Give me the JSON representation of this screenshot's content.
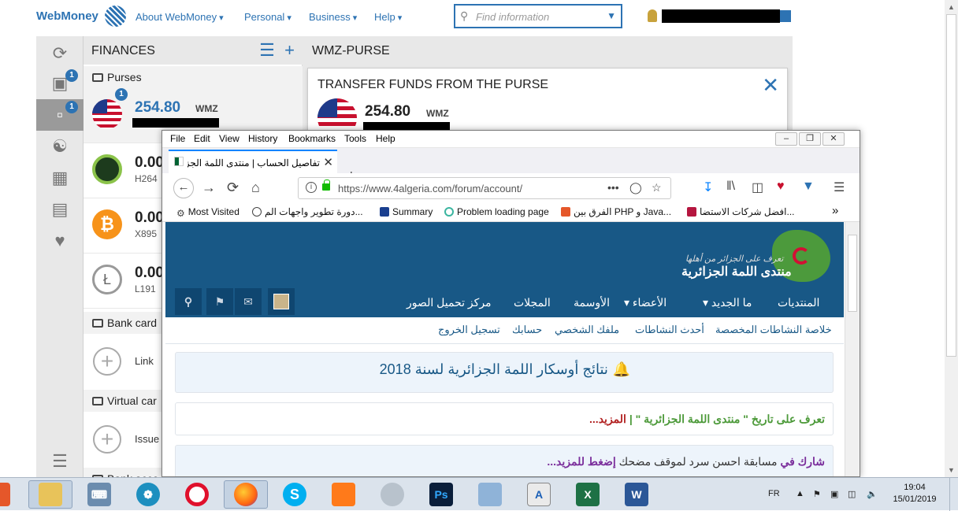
{
  "webmoney": {
    "logo": "WebMoney",
    "nav": [
      "About WebMoney",
      "Personal",
      "Business",
      "Help"
    ],
    "search_placeholder": "Find information",
    "left_badges": [
      "1",
      "1"
    ],
    "finances_title": "FINANCES",
    "purses_label": "Purses",
    "purses": [
      {
        "amount": "254.80",
        "currency": "WMZ",
        "id": "",
        "badge": "1"
      },
      {
        "amount": "0.00",
        "currency": "",
        "id": "H264"
      },
      {
        "amount": "0.00",
        "currency": "",
        "id": "X895"
      },
      {
        "amount": "0.00",
        "currency": "",
        "id": "L191"
      }
    ],
    "bank_cards_label": "Bank card",
    "link_label": "Link",
    "virtual_cards_label": "Virtual car",
    "issue_label": "Issue",
    "bank_accounts_label": "Bank acco",
    "main_title": "WMZ-PURSE",
    "transfer_title": "TRANSFER FUNDS FROM THE PURSE",
    "transfer_amount": "254.80",
    "transfer_currency": "WMZ"
  },
  "firefox": {
    "menu": [
      "File",
      "Edit",
      "View",
      "History",
      "Bookmarks",
      "Tools",
      "Help"
    ],
    "tab_title": "تفاصيل الحساب | منتدى اللمة الجزائرية",
    "url": "https://www.4algeria.com/forum/account/",
    "bookmarks": [
      "Most Visited",
      "دورة تطوير واجهات الم...",
      "Summary",
      "Problem loading page",
      "الفرق بين PHP و Java...",
      "افضل شركات الاستضا..."
    ],
    "site": {
      "tagline": "تعرف على الجزائر من أهلها",
      "name": "منتدى اللمة الجزائرية",
      "nav": [
        "المنتديات",
        "ما الجديد",
        "الأعضاء",
        "الأوسمة",
        "المجلات",
        "مركز تحميل الصور"
      ],
      "subnav": [
        "خلاصة النشاطات المخصصة",
        "أحدث النشاطات",
        "ملفك الشخصي",
        "حسابك",
        "تسجيل الخروج"
      ],
      "notice_title": "نتائج أوسكار اللمة الجزائرية لسنة 2018",
      "notice2_main": "تعرف على تاريخ \" منتدى اللمة الجزائرية \" |",
      "notice2_more": "المزيد...",
      "notice3_prefix": "شارك في",
      "notice3_main": "مسابقة احسن سرد لموقف مضحك",
      "notice3_more": "إضغط للمزيد..."
    }
  },
  "taskbar": {
    "lang": "FR",
    "time": "19:04",
    "date": "15/01/2019"
  },
  "colors": {
    "webmoney_blue": "#2d73b3",
    "forum_header": "#185886",
    "firefox_accent": "#0a84ff"
  }
}
